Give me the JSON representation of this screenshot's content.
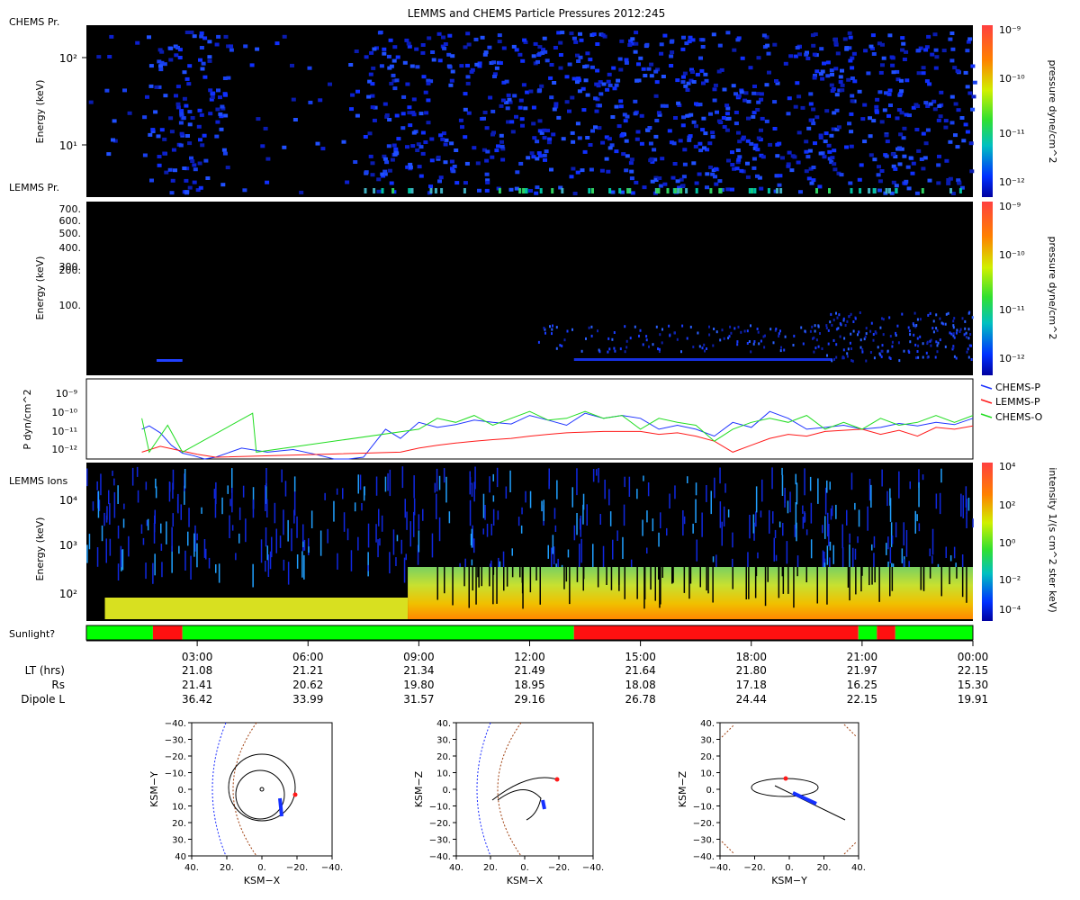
{
  "title": "LEMMS and CHEMS Particle Pressures  2012:245",
  "colors": {
    "blue_line": "#1f34ff",
    "red_line": "#ff1a1a",
    "green_line": "#22dd22",
    "sunlight_yes": "#00ff00",
    "sunlight_no": "#ff1010"
  },
  "panels": {
    "chems": {
      "label": "CHEMS Pr.",
      "ylabel": "Energy (keV)",
      "yticks": [
        "10²",
        "10¹"
      ],
      "cbar_label": "pressure dyne/cm^2",
      "cbar_ticks": [
        "10⁻⁹",
        "10⁻¹⁰",
        "10⁻¹¹",
        "10⁻¹²"
      ]
    },
    "lemms": {
      "label": "LEMMS Pr.",
      "ylabel": "Energy (keV)",
      "yticks": [
        "700.",
        "600.",
        "500.",
        "400.",
        "300.",
        "200.",
        "100."
      ],
      "cbar_label": "pressure dyne/cm^2",
      "cbar_ticks": [
        "10⁻⁹",
        "10⁻¹⁰",
        "10⁻¹¹",
        "10⁻¹²"
      ]
    },
    "pressure": {
      "ylabel": "P dyn/cm^2",
      "yticks": [
        "10⁻⁹",
        "10⁻¹⁰",
        "10⁻¹¹",
        "10⁻¹²"
      ],
      "legend": [
        "CHEMS-P",
        "LEMMS-P",
        "CHEMS-O"
      ]
    },
    "ions": {
      "label": "LEMMS Ions",
      "ylabel": "Energy (keV)",
      "yticks": [
        "10⁴",
        "10³",
        "10²"
      ],
      "cbar_label": "intensity 1/(s cm^2 ster keV)",
      "cbar_ticks": [
        "10⁴",
        "10²",
        "10⁰",
        "10⁻²",
        "10⁻⁴"
      ]
    },
    "sunlight": {
      "label": "Sunlight?"
    }
  },
  "time_axis": {
    "ticks": [
      "03:00",
      "06:00",
      "09:00",
      "12:00",
      "15:00",
      "18:00",
      "21:00",
      "00:00"
    ],
    "rows": [
      {
        "label": "LT (hrs)",
        "values": [
          "21.08",
          "21.21",
          "21.34",
          "21.49",
          "21.64",
          "21.80",
          "21.97",
          "22.15"
        ]
      },
      {
        "label": "Rs",
        "values": [
          "21.41",
          "20.62",
          "19.80",
          "18.95",
          "18.08",
          "17.18",
          "16.25",
          "15.30"
        ]
      },
      {
        "label": "Dipole L",
        "values": [
          "36.42",
          "33.99",
          "31.57",
          "29.16",
          "26.78",
          "24.44",
          "22.15",
          "19.91"
        ]
      }
    ]
  },
  "orbits": [
    {
      "xlabel": "KSM−X",
      "ylabel": "KSM−Y",
      "xticks": [
        "40.",
        "20.",
        "0.",
        "−20.",
        "−40."
      ],
      "yticks": [
        "−40.",
        "−30.",
        "−20.",
        "−10.",
        "0.",
        "10.",
        "20.",
        "30.",
        "40"
      ]
    },
    {
      "xlabel": "KSM−X",
      "ylabel": "KSM−Z",
      "xticks": [
        "40.",
        "20.",
        "0.",
        "−20.",
        "−40."
      ],
      "yticks": [
        "40.",
        "30.",
        "20.",
        "10.",
        "0.",
        "−10.",
        "−20.",
        "−30.",
        "−40."
      ]
    },
    {
      "xlabel": "KSM−Y",
      "ylabel": "KSM−Z",
      "xticks": [
        "−40.",
        "−20.",
        "0.",
        "20.",
        "40."
      ],
      "yticks": [
        "40.",
        "30.",
        "20.",
        "10.",
        "0.",
        "−10.",
        "−20.",
        "−30.",
        "−40."
      ]
    }
  ],
  "chart_data": [
    {
      "type": "heatmap",
      "title": "LEMMS and CHEMS Particle Pressures  2012:245",
      "name": "CHEMS Pr.",
      "xlabel": "",
      "ylabel": "Energy (keV)",
      "x_range_hours": [
        0,
        24
      ],
      "y_scale": "log",
      "colorbar": {
        "label": "pressure dyne/cm^2",
        "range": [
          "1e-12",
          "1e-9"
        ],
        "scale": "log"
      }
    },
    {
      "type": "heatmap",
      "name": "LEMMS Pr.",
      "ylabel": "Energy (keV)",
      "x_range_hours": [
        0,
        24
      ],
      "y_scale": "log",
      "colorbar": {
        "label": "pressure dyne/cm^2",
        "range": [
          "1e-12",
          "1e-9"
        ],
        "scale": "log"
      }
    },
    {
      "type": "line",
      "ylabel": "P dyn/cm^2",
      "y_scale": "log",
      "ylim": [
        "1e-12",
        "1e-9"
      ],
      "x_unit": "hours",
      "series": [
        {
          "name": "CHEMS-P",
          "color": "#1f34ff",
          "x": [
            1.5,
            1.7,
            2.0,
            2.3,
            2.6,
            2.9,
            3.2,
            3.5,
            4.2,
            4.9,
            5.6,
            6.2,
            6.7,
            7.1,
            7.5,
            8.1,
            8.5,
            9.0,
            9.5,
            10.0,
            10.5,
            11.0,
            11.5,
            12.0,
            12.5,
            13.0,
            13.5,
            14.0,
            14.5,
            15.0,
            15.5,
            16.0,
            16.5,
            17.0,
            17.5,
            18.0,
            18.5,
            19.0,
            19.5,
            20.0,
            20.5,
            21.0,
            21.5,
            22.0,
            22.5,
            23.0,
            23.5,
            24.0
          ],
          "y": [
            1e-11,
            1.4e-11,
            7e-12,
            2e-12,
            9e-13,
            7e-13,
            5e-13,
            6e-13,
            1.5e-12,
            1e-12,
            1.3e-12,
            8e-13,
            5e-13,
            4e-13,
            6e-13,
            1e-11,
            4e-12,
            2e-11,
            1.2e-11,
            1.6e-11,
            2.5e-11,
            2e-11,
            1.7e-11,
            4e-11,
            2.5e-11,
            1.5e-11,
            5e-11,
            3e-11,
            4e-11,
            3e-11,
            1e-11,
            1.5e-11,
            1e-11,
            5e-12,
            2e-11,
            1.2e-11,
            6e-11,
            3e-11,
            1e-11,
            1.2e-11,
            1.5e-11,
            1e-11,
            1.2e-11,
            1.8e-11,
            1.4e-11,
            2e-11,
            1.6e-11,
            3e-11
          ]
        },
        {
          "name": "LEMMS-P",
          "color": "#ff1a1a",
          "x": [
            1.5,
            2.0,
            2.5,
            3.0,
            3.5,
            8.5,
            9.0,
            9.5,
            10.0,
            10.5,
            11.0,
            11.5,
            12.0,
            12.5,
            13.0,
            13.5,
            14.0,
            14.5,
            15.0,
            15.5,
            16.0,
            16.5,
            17.0,
            17.5,
            18.0,
            18.5,
            19.0,
            19.5,
            20.0,
            20.5,
            21.0,
            21.5,
            22.0,
            22.5,
            23.0,
            23.5,
            24.0
          ],
          "y": [
            1e-12,
            1.8e-12,
            1.2e-12,
            8e-13,
            6e-13,
            1e-12,
            1.5e-12,
            2e-12,
            2.5e-12,
            3e-12,
            3.5e-12,
            4e-12,
            5e-12,
            6e-12,
            7e-12,
            7.5e-12,
            8e-12,
            8e-12,
            8e-12,
            6e-12,
            7e-12,
            5e-12,
            3e-12,
            1e-12,
            2e-12,
            4e-12,
            6e-12,
            5e-12,
            8e-12,
            9e-12,
            1e-11,
            6e-12,
            9e-12,
            5e-12,
            1.2e-11,
            1e-11,
            1.4e-11
          ]
        },
        {
          "name": "CHEMS-O",
          "color": "#22dd22",
          "x": [
            1.5,
            1.7,
            2.2,
            2.6,
            4.5,
            4.6,
            9.0,
            9.5,
            10.0,
            10.5,
            11.0,
            11.5,
            12.0,
            12.5,
            13.0,
            13.5,
            14.0,
            14.5,
            15.0,
            15.5,
            16.0,
            16.5,
            17.0,
            17.5,
            18.0,
            18.5,
            19.0,
            19.5,
            20.0,
            20.5,
            21.0,
            21.5,
            22.0,
            22.5,
            23.0,
            23.5,
            24.0
          ],
          "y": [
            3e-11,
            1e-12,
            1.5e-11,
            1e-12,
            5e-11,
            1e-12,
            1e-11,
            3e-11,
            2e-11,
            4e-11,
            1.5e-11,
            3e-11,
            6e-11,
            2.5e-11,
            3e-11,
            6e-11,
            3e-11,
            4e-11,
            1e-11,
            3e-11,
            2e-11,
            1.5e-11,
            3e-12,
            1e-11,
            2e-11,
            3e-11,
            2e-11,
            4e-11,
            1e-11,
            2e-11,
            1e-11,
            3e-11,
            1.5e-11,
            2e-11,
            4e-11,
            2e-11,
            4e-11
          ]
        }
      ]
    },
    {
      "type": "heatmap",
      "name": "LEMMS Ions",
      "ylabel": "Energy (keV)",
      "x_range_hours": [
        0,
        24
      ],
      "y_scale": "log",
      "colorbar": {
        "label": "intensity 1/(s cm^2 ster keV)",
        "range": [
          "1e-4",
          "1e4"
        ],
        "scale": "log"
      }
    },
    {
      "type": "bar",
      "name": "Sunlight?",
      "segments_hours": [
        {
          "start": 0.0,
          "end": 1.8,
          "sunlit": true
        },
        {
          "start": 1.8,
          "end": 2.6,
          "sunlit": false
        },
        {
          "start": 2.6,
          "end": 13.2,
          "sunlit": true
        },
        {
          "start": 13.2,
          "end": 20.9,
          "sunlit": false
        },
        {
          "start": 20.9,
          "end": 21.4,
          "sunlit": true
        },
        {
          "start": 21.4,
          "end": 21.9,
          "sunlit": false
        },
        {
          "start": 21.9,
          "end": 24.0,
          "sunlit": true
        }
      ]
    }
  ]
}
